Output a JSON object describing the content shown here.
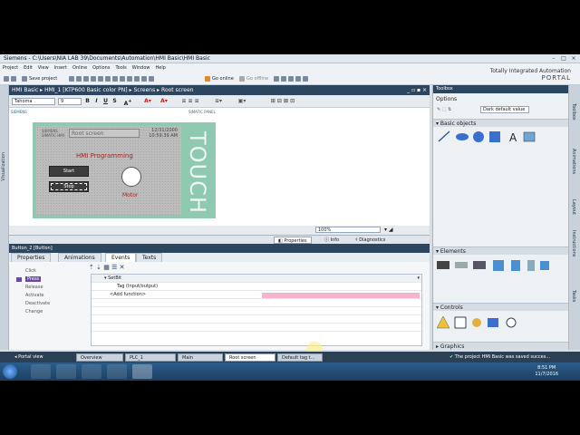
{
  "window": {
    "title": "Siemens - C:\\Users\\NIA LAB 39\\Documents\\Automation\\HMI Basic\\HMI Basic"
  },
  "menu": [
    "Project",
    "Edit",
    "View",
    "Insert",
    "Online",
    "Options",
    "Tools",
    "Window",
    "Help"
  ],
  "toolbar": {
    "save_project": "Save project",
    "go_online": "Go online",
    "go_offline": "Go offline"
  },
  "brand": {
    "line1": "Totally Integrated Automation",
    "line2": "PORTAL"
  },
  "left_strip": {
    "label": "Visualization"
  },
  "editor": {
    "breadcrumb": "HMI Basic ▸ HMI_1 [KTP600 Basic color PN] ▸ Screens ▸ Root screen",
    "font": "Tahoma",
    "font_size": "9",
    "zoom": "100%"
  },
  "device": {
    "brand": "SIEMENS",
    "model_top": "SIMATIC HMI",
    "touch_top": "SIMATIC PANEL",
    "screen_field": "Root screen",
    "date": "12/31/2000",
    "time": "10:59:39 AM",
    "title": "HMI Programming",
    "start_label": "Start",
    "stop_label": "Stop",
    "motor_label": "Motor",
    "touch": "TOUCH"
  },
  "properties": {
    "tabs": {
      "properties": "Properties",
      "info": "Info",
      "diagnostics": "Diagnostics"
    },
    "element": "Button_2 [Button]",
    "subtabs": [
      "Properties",
      "Animations",
      "Events",
      "Texts"
    ],
    "events": [
      "Click",
      "Press",
      "Release",
      "Activate",
      "Deactivate",
      "Change"
    ],
    "function": "SetBit",
    "tag_param": "Tag (Input/output)",
    "add_function": "<Add function>"
  },
  "toolbox": {
    "title": "Toolbox",
    "options": "Options",
    "dark_default": "Dark default value",
    "sections": [
      "Basic objects",
      "Elements",
      "Controls",
      "Graphics"
    ],
    "right_tabs": [
      "Toolbox",
      "Animations",
      "Layout",
      "Instructions",
      "Tasks"
    ]
  },
  "portal_bar": {
    "portal_view": "Portal view",
    "tabs": [
      "Overview",
      "PLC_1",
      "Main",
      "Root screen",
      "Default tag t..."
    ],
    "status": "The project HMI Basic was saved succes..."
  },
  "taskbar": {
    "time": "8:51 PM",
    "date": "11/7/2016"
  }
}
